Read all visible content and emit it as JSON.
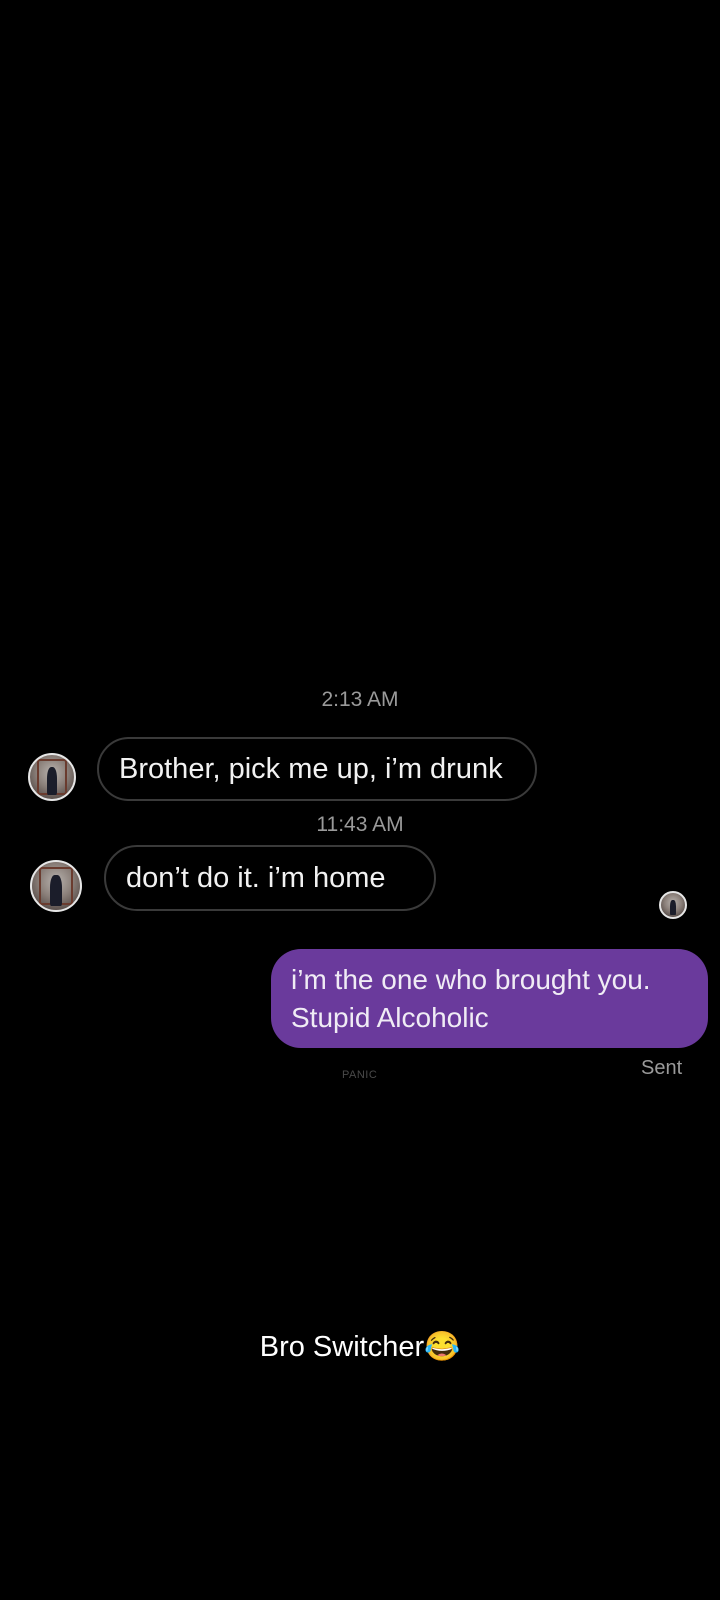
{
  "conversation": {
    "messages": [
      {
        "timestamp": "2:13 AM",
        "direction": "incoming",
        "text": "Brother, pick me up, i’m drunk"
      },
      {
        "timestamp": "11:43 AM",
        "direction": "incoming",
        "text": "don’t do it. i’m home"
      },
      {
        "direction": "outgoing",
        "lines": [
          "i’m the one who brought you.",
          "Stupid Alcoholic"
        ],
        "status": "Sent"
      }
    ],
    "watermark": "PANIC"
  },
  "caption": {
    "text": "Bro Switcher😂"
  },
  "colors": {
    "background": "#000000",
    "outgoing_bubble": "#6a3a9c",
    "incoming_border": "#3a3a3a",
    "muted_text": "#9a9a9a"
  }
}
